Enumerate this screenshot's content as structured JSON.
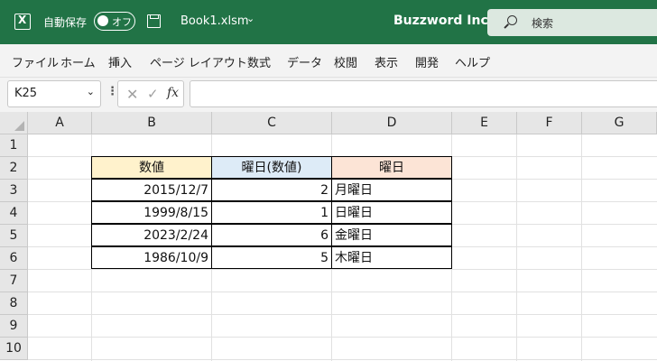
{
  "titlebar": {
    "autosave_label": "自動保存",
    "toggle_text": "オフ",
    "filename": "Book1.xlsm",
    "filename_chevron": "⌄",
    "brand": "Buzzword Inc.",
    "search_placeholder": "検索",
    "bg_color": "#217346"
  },
  "menu": [
    "ファイル",
    "ホーム",
    "挿入",
    "ページ レイアウト",
    "数式",
    "データ",
    "校閲",
    "表示",
    "開発",
    "ヘルプ"
  ],
  "formula_bar": {
    "name_box": "K25",
    "cancel": "✕",
    "enter": "✓",
    "fx": "fx",
    "formula": ""
  },
  "columns": [
    "A",
    "B",
    "C",
    "D",
    "E",
    "F",
    "G"
  ],
  "rows": [
    "1",
    "2",
    "3",
    "4",
    "5",
    "6",
    "7",
    "8",
    "9",
    "10"
  ],
  "table": {
    "headers": [
      "数値",
      "曜日(数値)",
      "曜日"
    ],
    "header_colors": [
      "#fff2cc",
      "#ddebf7",
      "#fce4d6"
    ],
    "rows": [
      [
        "2015/12/7",
        "2",
        "月曜日"
      ],
      [
        "1999/8/15",
        "1",
        "日曜日"
      ],
      [
        "2023/2/24",
        "6",
        "金曜日"
      ],
      [
        "1986/10/9",
        "5",
        "木曜日"
      ]
    ]
  }
}
